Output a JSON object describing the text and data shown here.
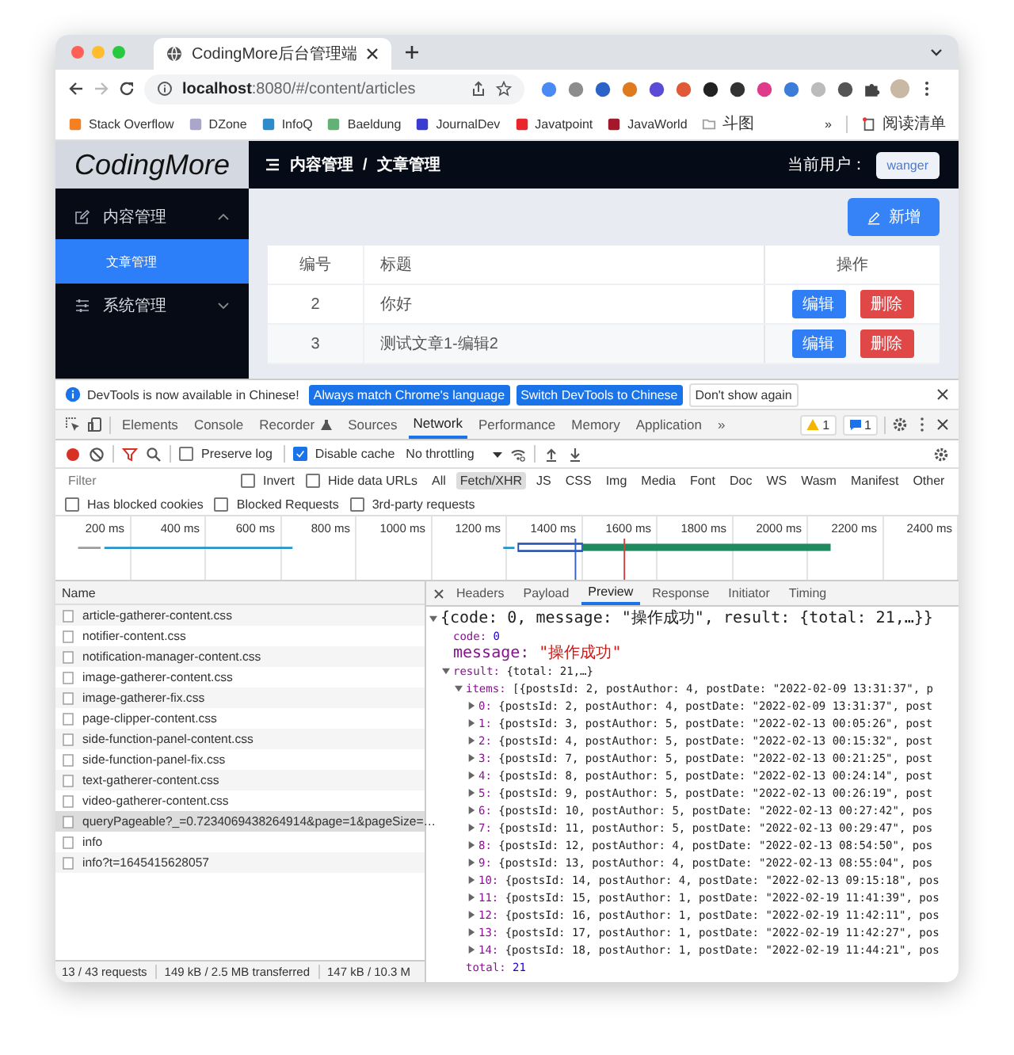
{
  "browser": {
    "tab": {
      "title": "CodingMore后台管理端"
    },
    "address": "**localhost**:8080/#/content/articles",
    "bookmarks": [
      {
        "label": "Stack Overflow",
        "kind": "site",
        "color": "#f48024"
      },
      {
        "label": "DZone",
        "kind": "site",
        "color": "#a9a6c9"
      },
      {
        "label": "InfoQ",
        "kind": "site",
        "color": "#2d8bc9"
      },
      {
        "label": "Baeldung",
        "kind": "site",
        "color": "#63b175"
      },
      {
        "label": "JournalDev",
        "kind": "site",
        "color": "#3b3bd0"
      },
      {
        "label": "Javatpoint",
        "kind": "site",
        "color": "#e8262c"
      },
      {
        "label": "JavaWorld",
        "kind": "site",
        "color": "#a3182a"
      },
      {
        "label": "斗图",
        "kind": "folder",
        "color": "#9e9e9e"
      }
    ],
    "bookmarks_more": "»",
    "reading_list": "阅读清单"
  },
  "app": {
    "logo": "CodingMore",
    "breadcrumb": [
      "内容管理",
      "文章管理"
    ],
    "breadcrumb_separator": "/",
    "user_label": "当前用户：",
    "user": "wanger",
    "menu": [
      {
        "label": "内容管理",
        "expanded": true,
        "selected": false,
        "children": [
          {
            "label": "文章管理",
            "selected": true
          }
        ]
      },
      {
        "label": "系统管理",
        "expanded": false,
        "selected": false
      }
    ],
    "add_button": "新增",
    "table": {
      "columns": [
        "编号",
        "标题",
        "操作"
      ],
      "rows": [
        {
          "id": "2",
          "title": "你好",
          "actions": [
            "编辑",
            "删除"
          ]
        },
        {
          "id": "3",
          "title": "测试文章1-编辑2",
          "actions": [
            "编辑",
            "删除"
          ]
        }
      ]
    }
  },
  "devtools": {
    "notice": {
      "text": "DevTools is now available in Chinese!",
      "buttons": [
        {
          "label": "Always match Chrome's language",
          "kind": "primary"
        },
        {
          "label": "Switch DevTools to Chinese",
          "kind": "primary"
        },
        {
          "label": "Don't show again",
          "kind": "plain"
        }
      ]
    },
    "tabs": [
      {
        "label": "Elements",
        "selected": false
      },
      {
        "label": "Console",
        "selected": false
      },
      {
        "label": "Recorder",
        "selected": false
      },
      {
        "label": "Sources",
        "selected": false
      },
      {
        "label": "Network",
        "selected": true
      },
      {
        "label": "Performance",
        "selected": false
      },
      {
        "label": "Memory",
        "selected": false
      },
      {
        "label": "Application",
        "selected": false
      }
    ],
    "tabs_more": "»",
    "warnings": "1",
    "messages": "1",
    "toolbar": {
      "recording": true,
      "preserve_log": {
        "label": "Preserve log",
        "checked": false
      },
      "disable_cache": {
        "label": "Disable cache",
        "checked": true
      },
      "throttling": "No throttling"
    },
    "filter": {
      "placeholder": "Filter",
      "invert": {
        "label": "Invert",
        "checked": false
      },
      "hide_data_urls": {
        "label": "Hide data URLs",
        "checked": false
      },
      "types": [
        {
          "label": "All",
          "selected": false
        },
        {
          "label": "Fetch/XHR",
          "selected": true
        },
        {
          "label": "JS",
          "selected": false
        },
        {
          "label": "CSS",
          "selected": false
        },
        {
          "label": "Img",
          "selected": false
        },
        {
          "label": "Media",
          "selected": false
        },
        {
          "label": "Font",
          "selected": false
        },
        {
          "label": "Doc",
          "selected": false
        },
        {
          "label": "WS",
          "selected": false
        },
        {
          "label": "Wasm",
          "selected": false
        },
        {
          "label": "Manifest",
          "selected": false
        },
        {
          "label": "Other",
          "selected": false
        }
      ]
    },
    "blocked": [
      {
        "label": "Has blocked cookies",
        "checked": false
      },
      {
        "label": "Blocked Requests",
        "checked": false
      },
      {
        "label": "3rd-party requests",
        "checked": false
      }
    ],
    "timeline": {
      "ticks": [
        "200 ms",
        "400 ms",
        "600 ms",
        "800 ms",
        "1000 ms",
        "1200 ms",
        "1400 ms",
        "1600 ms",
        "1800 ms",
        "2000 ms",
        "2200 ms",
        "2400 ms"
      ]
    },
    "requests": {
      "header": "Name",
      "items": [
        {
          "name": "article-gatherer-content.css",
          "selected": false
        },
        {
          "name": "notifier-content.css",
          "selected": false
        },
        {
          "name": "notification-manager-content.css",
          "selected": false
        },
        {
          "name": "image-gatherer-content.css",
          "selected": false
        },
        {
          "name": "image-gatherer-fix.css",
          "selected": false
        },
        {
          "name": "page-clipper-content.css",
          "selected": false
        },
        {
          "name": "side-function-panel-content.css",
          "selected": false
        },
        {
          "name": "side-function-panel-fix.css",
          "selected": false
        },
        {
          "name": "text-gatherer-content.css",
          "selected": false
        },
        {
          "name": "video-gatherer-content.css",
          "selected": false
        },
        {
          "name": "queryPageable?_=0.7234069438264914&page=1&pageSize=…",
          "selected": true
        },
        {
          "name": "info",
          "selected": false
        },
        {
          "name": "info?t=1645415628057",
          "selected": false
        }
      ]
    },
    "status": [
      "13 / 43 requests",
      "149 kB / 2.5 MB transferred",
      "147 kB / 10.3 M"
    ],
    "detail_tabs": [
      {
        "label": "Headers",
        "selected": false
      },
      {
        "label": "Payload",
        "selected": false
      },
      {
        "label": "Preview",
        "selected": true
      },
      {
        "label": "Response",
        "selected": false
      },
      {
        "label": "Initiator",
        "selected": false
      },
      {
        "label": "Timing",
        "selected": false
      }
    ],
    "preview": {
      "tree": {
        "kind": "object",
        "summary": "{code: 0, message: \"操作成功\", result: {total: 21,…}}",
        "expanded": true,
        "children": [
          {
            "key": "code:",
            "kind": "number",
            "value": "0"
          },
          {
            "key": "message:",
            "kind": "string",
            "value": "\"操作成功\""
          },
          {
            "key": "result:",
            "kind": "object",
            "summary": "{total: 21,…}",
            "expanded": true,
            "children": [
              {
                "key": "items:",
                "kind": "object",
                "summary": "[{postsId: 2, postAuthor: 4, postDate: \"2022-02-09 13:31:37\", p",
                "expanded": true,
                "children": [
                  {
                    "key": "0:",
                    "kind": "object",
                    "summary": "{postsId: 2, postAuthor: 4, postDate: \"2022-02-09 13:31:37\", post",
                    "expanded": false
                  },
                  {
                    "key": "1:",
                    "kind": "object",
                    "summary": "{postsId: 3, postAuthor: 5, postDate: \"2022-02-13 00:05:26\", post",
                    "expanded": false
                  },
                  {
                    "key": "2:",
                    "kind": "object",
                    "summary": "{postsId: 4, postAuthor: 5, postDate: \"2022-02-13 00:15:32\", post",
                    "expanded": false
                  },
                  {
                    "key": "3:",
                    "kind": "object",
                    "summary": "{postsId: 7, postAuthor: 5, postDate: \"2022-02-13 00:21:25\", post",
                    "expanded": false
                  },
                  {
                    "key": "4:",
                    "kind": "object",
                    "summary": "{postsId: 8, postAuthor: 5, postDate: \"2022-02-13 00:24:14\", post",
                    "expanded": false
                  },
                  {
                    "key": "5:",
                    "kind": "object",
                    "summary": "{postsId: 9, postAuthor: 5, postDate: \"2022-02-13 00:26:19\", post",
                    "expanded": false
                  },
                  {
                    "key": "6:",
                    "kind": "object",
                    "summary": "{postsId: 10, postAuthor: 5, postDate: \"2022-02-13 00:27:42\", pos",
                    "expanded": false
                  },
                  {
                    "key": "7:",
                    "kind": "object",
                    "summary": "{postsId: 11, postAuthor: 5, postDate: \"2022-02-13 00:29:47\", pos",
                    "expanded": false
                  },
                  {
                    "key": "8:",
                    "kind": "object",
                    "summary": "{postsId: 12, postAuthor: 4, postDate: \"2022-02-13 08:54:50\", pos",
                    "expanded": false
                  },
                  {
                    "key": "9:",
                    "kind": "object",
                    "summary": "{postsId: 13, postAuthor: 4, postDate: \"2022-02-13 08:55:04\", pos",
                    "expanded": false
                  },
                  {
                    "key": "10:",
                    "kind": "object",
                    "summary": "{postsId: 14, postAuthor: 4, postDate: \"2022-02-13 09:15:18\", pos",
                    "expanded": false
                  },
                  {
                    "key": "11:",
                    "kind": "object",
                    "summary": "{postsId: 15, postAuthor: 1, postDate: \"2022-02-19 11:41:39\", pos",
                    "expanded": false
                  },
                  {
                    "key": "12:",
                    "kind": "object",
                    "summary": "{postsId: 16, postAuthor: 1, postDate: \"2022-02-19 11:42:11\", pos",
                    "expanded": false
                  },
                  {
                    "key": "13:",
                    "kind": "object",
                    "summary": "{postsId: 17, postAuthor: 1, postDate: \"2022-02-19 11:42:27\", pos",
                    "expanded": false
                  },
                  {
                    "key": "14:",
                    "kind": "object",
                    "summary": "{postsId: 18, postAuthor: 1, postDate: \"2022-02-19 11:44:21\", pos",
                    "expanded": false
                  }
                ]
              },
              {
                "key": "total:",
                "kind": "number",
                "value": "21"
              }
            ]
          }
        ]
      }
    }
  }
}
